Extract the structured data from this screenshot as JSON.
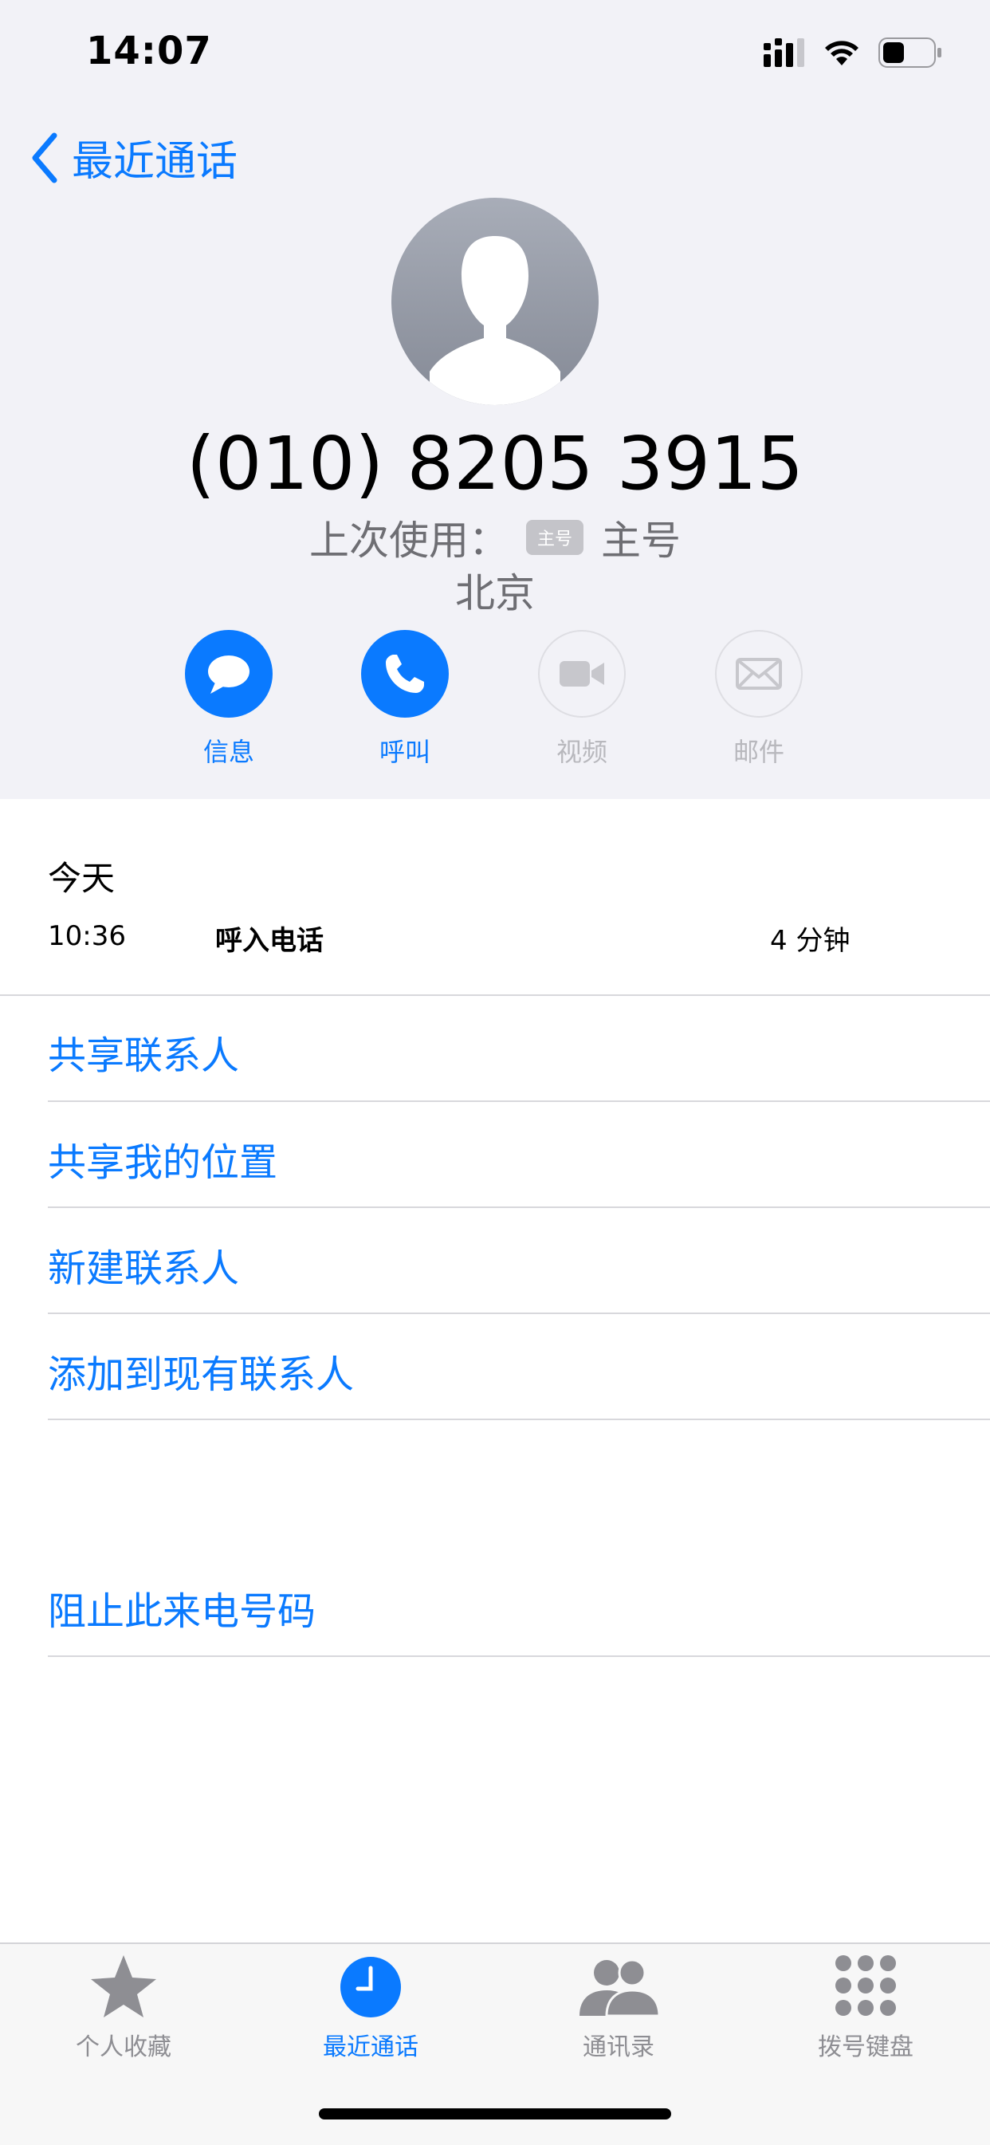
{
  "status": {
    "time": "14:07"
  },
  "nav": {
    "back_label": "最近通话"
  },
  "contact": {
    "number": "(010) 8205 3915",
    "last_used_label": "上次使用：",
    "line_badge": "主号",
    "line_name": "主号",
    "location": "北京"
  },
  "actions": [
    {
      "label": "信息",
      "icon": "message-icon",
      "enabled": true
    },
    {
      "label": "呼叫",
      "icon": "phone-icon",
      "enabled": true
    },
    {
      "label": "视频",
      "icon": "video-icon",
      "enabled": false
    },
    {
      "label": "邮件",
      "icon": "mail-icon",
      "enabled": false
    }
  ],
  "history": {
    "day": "今天",
    "entries": [
      {
        "time": "10:36",
        "type": "呼入电话",
        "duration": "4 分钟"
      }
    ]
  },
  "options": [
    "共享联系人",
    "共享我的位置",
    "新建联系人",
    "添加到现有联系人"
  ],
  "block_option": "阻止此来电号码",
  "tabs": [
    {
      "label": "个人收藏",
      "icon": "star-icon",
      "active": false
    },
    {
      "label": "最近通话",
      "icon": "clock-icon",
      "active": true
    },
    {
      "label": "通讯录",
      "icon": "contacts-icon",
      "active": false
    },
    {
      "label": "拨号键盘",
      "icon": "keypad-icon",
      "active": false
    }
  ],
  "colors": {
    "accent": "#0a7aff",
    "inactive": "#8e8e93",
    "header_bg": "#f2f2f7"
  }
}
